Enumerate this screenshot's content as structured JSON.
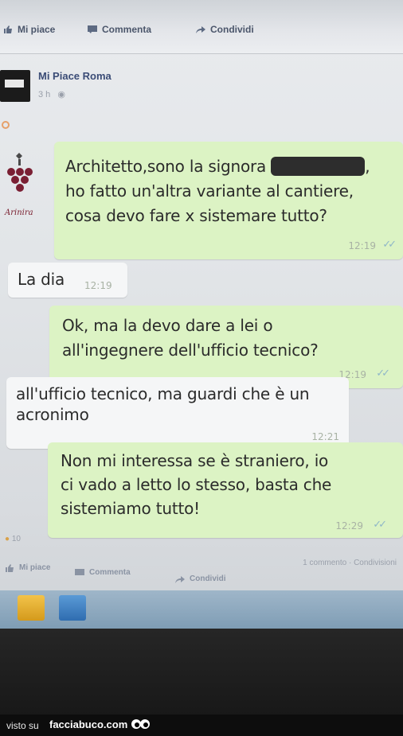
{
  "post_actions": {
    "like": "Mi piace",
    "comment": "Commenta",
    "share": "Condividi"
  },
  "post": {
    "page_name": "Mi Piace Roma",
    "time_ago": "3 h"
  },
  "chat": {
    "logo_label": "Arinira",
    "messages": [
      {
        "direction": "outgoing",
        "lines": [
          "Architetto,sono la signora",
          "ho fatto un'altra variante al cantiere,",
          "cosa devo fare x sistemare tutto?"
        ],
        "time": "12:19",
        "ticks": "✓✓"
      },
      {
        "direction": "incoming",
        "lines": [
          "La dia"
        ],
        "time": "12:19"
      },
      {
        "direction": "outgoing",
        "lines": [
          "Ok, ma la devo dare a lei o",
          "all'ingegnere dell'ufficio tecnico?"
        ],
        "time": "12:19",
        "ticks": "✓✓"
      },
      {
        "direction": "incoming",
        "lines": [
          "all'ufficio tecnico, ma guardi che è un",
          "acronimo"
        ],
        "time": "12:21"
      },
      {
        "direction": "outgoing",
        "lines": [
          "Non mi interessa se è straniero, io",
          "ci vado a letto lo stesso, basta che",
          "sistemiamo tutto!"
        ],
        "time": "12:29",
        "ticks": "✓✓"
      }
    ]
  },
  "footer": {
    "reactions_count": "10",
    "comments_shares": "1 commento · Condivisioni",
    "like": "Mi piace",
    "comment": "Commenta",
    "share": "Condividi"
  },
  "watermark": {
    "prefix": "visto su",
    "site": "facciabuco.com"
  },
  "colors": {
    "outgoing_bubble": "#dcf3c4",
    "incoming_bubble": "#f5f6f7",
    "facebook_link": "#3b4c76",
    "tick_blue": "#8fb7c8"
  }
}
